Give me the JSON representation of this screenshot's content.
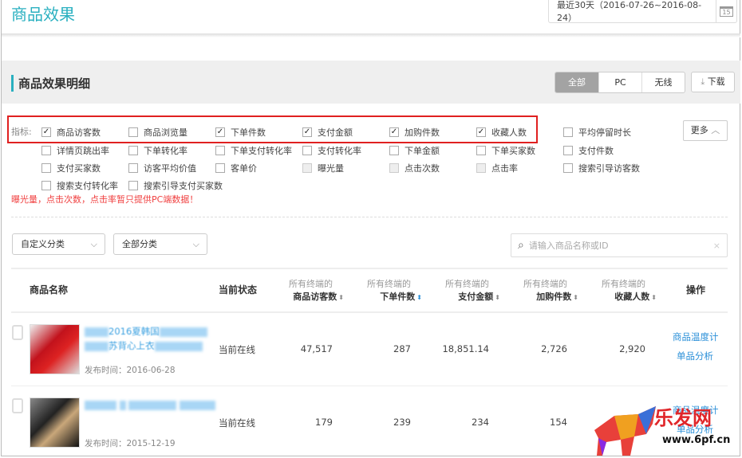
{
  "header": {
    "title": "商品效果",
    "date_range": "最近30天（2016-07-26~2016-08-24）",
    "calendar_day": "15"
  },
  "section": {
    "title": "商品效果明细",
    "segments": [
      "全部",
      "PC",
      "无线"
    ],
    "active_segment": "全部",
    "download": "下载"
  },
  "metrics": {
    "label": "指标:",
    "more": "更多",
    "items": [
      {
        "label": "商品访客数",
        "checked": true
      },
      {
        "label": "商品浏览量",
        "checked": false
      },
      {
        "label": "下单件数",
        "checked": true
      },
      {
        "label": "支付金额",
        "checked": true
      },
      {
        "label": "加购件数",
        "checked": true
      },
      {
        "label": "收藏人数",
        "checked": true
      },
      {
        "label": "平均停留时长",
        "checked": false
      },
      {
        "label": "详情页跳出率",
        "checked": false
      },
      {
        "label": "下单转化率",
        "checked": false
      },
      {
        "label": "下单支付转化率",
        "checked": false
      },
      {
        "label": "支付转化率",
        "checked": false
      },
      {
        "label": "下单金额",
        "checked": false
      },
      {
        "label": "下单买家数",
        "checked": false
      },
      {
        "label": "支付件数",
        "checked": false
      },
      {
        "label": "支付买家数",
        "checked": false
      },
      {
        "label": "访客平均价值",
        "checked": false
      },
      {
        "label": "客单价",
        "checked": false
      },
      {
        "label": "曝光量",
        "checked": false,
        "disabled": true
      },
      {
        "label": "点击次数",
        "checked": false,
        "disabled": true
      },
      {
        "label": "点击率",
        "checked": false,
        "disabled": true
      },
      {
        "label": "搜索引导访客数",
        "checked": false
      },
      {
        "label": "搜索支付转化率",
        "checked": false
      },
      {
        "label": "搜索引导支付买家数",
        "checked": false
      }
    ],
    "warning": "曝光量，点击次数，点击率暂只提供PC端数据！"
  },
  "filters": {
    "category1": "自定义分类",
    "category2": "全部分类",
    "search_placeholder": "请输入商品名称或ID"
  },
  "table": {
    "col_name": "商品名称",
    "col_status": "当前状态",
    "col_prefix": "所有终端的",
    "metric_cols": [
      "商品访客数",
      "下单件数",
      "支付金额",
      "加购件数",
      "收藏人数"
    ],
    "col_action": "操作",
    "rows": [
      {
        "title_fragments": [
          "2016夏韩国",
          "苏背心上衣"
        ],
        "published": "发布时间：2016-06-28",
        "status": "当前在线",
        "values": [
          "47,517",
          "287",
          "18,851.14",
          "2,726",
          "2,920"
        ],
        "actions": [
          "商品温度计",
          "单品分析"
        ]
      },
      {
        "title_fragments": [],
        "published": "发布时间：2015-12-19",
        "status": "当前在线",
        "values": [
          "179",
          "239",
          "234",
          "154",
          ""
        ],
        "actions": [
          "商品温度计",
          "单品分析"
        ]
      }
    ]
  },
  "watermark": {
    "name": "乐发网",
    "url": "www.6pf.cn"
  }
}
